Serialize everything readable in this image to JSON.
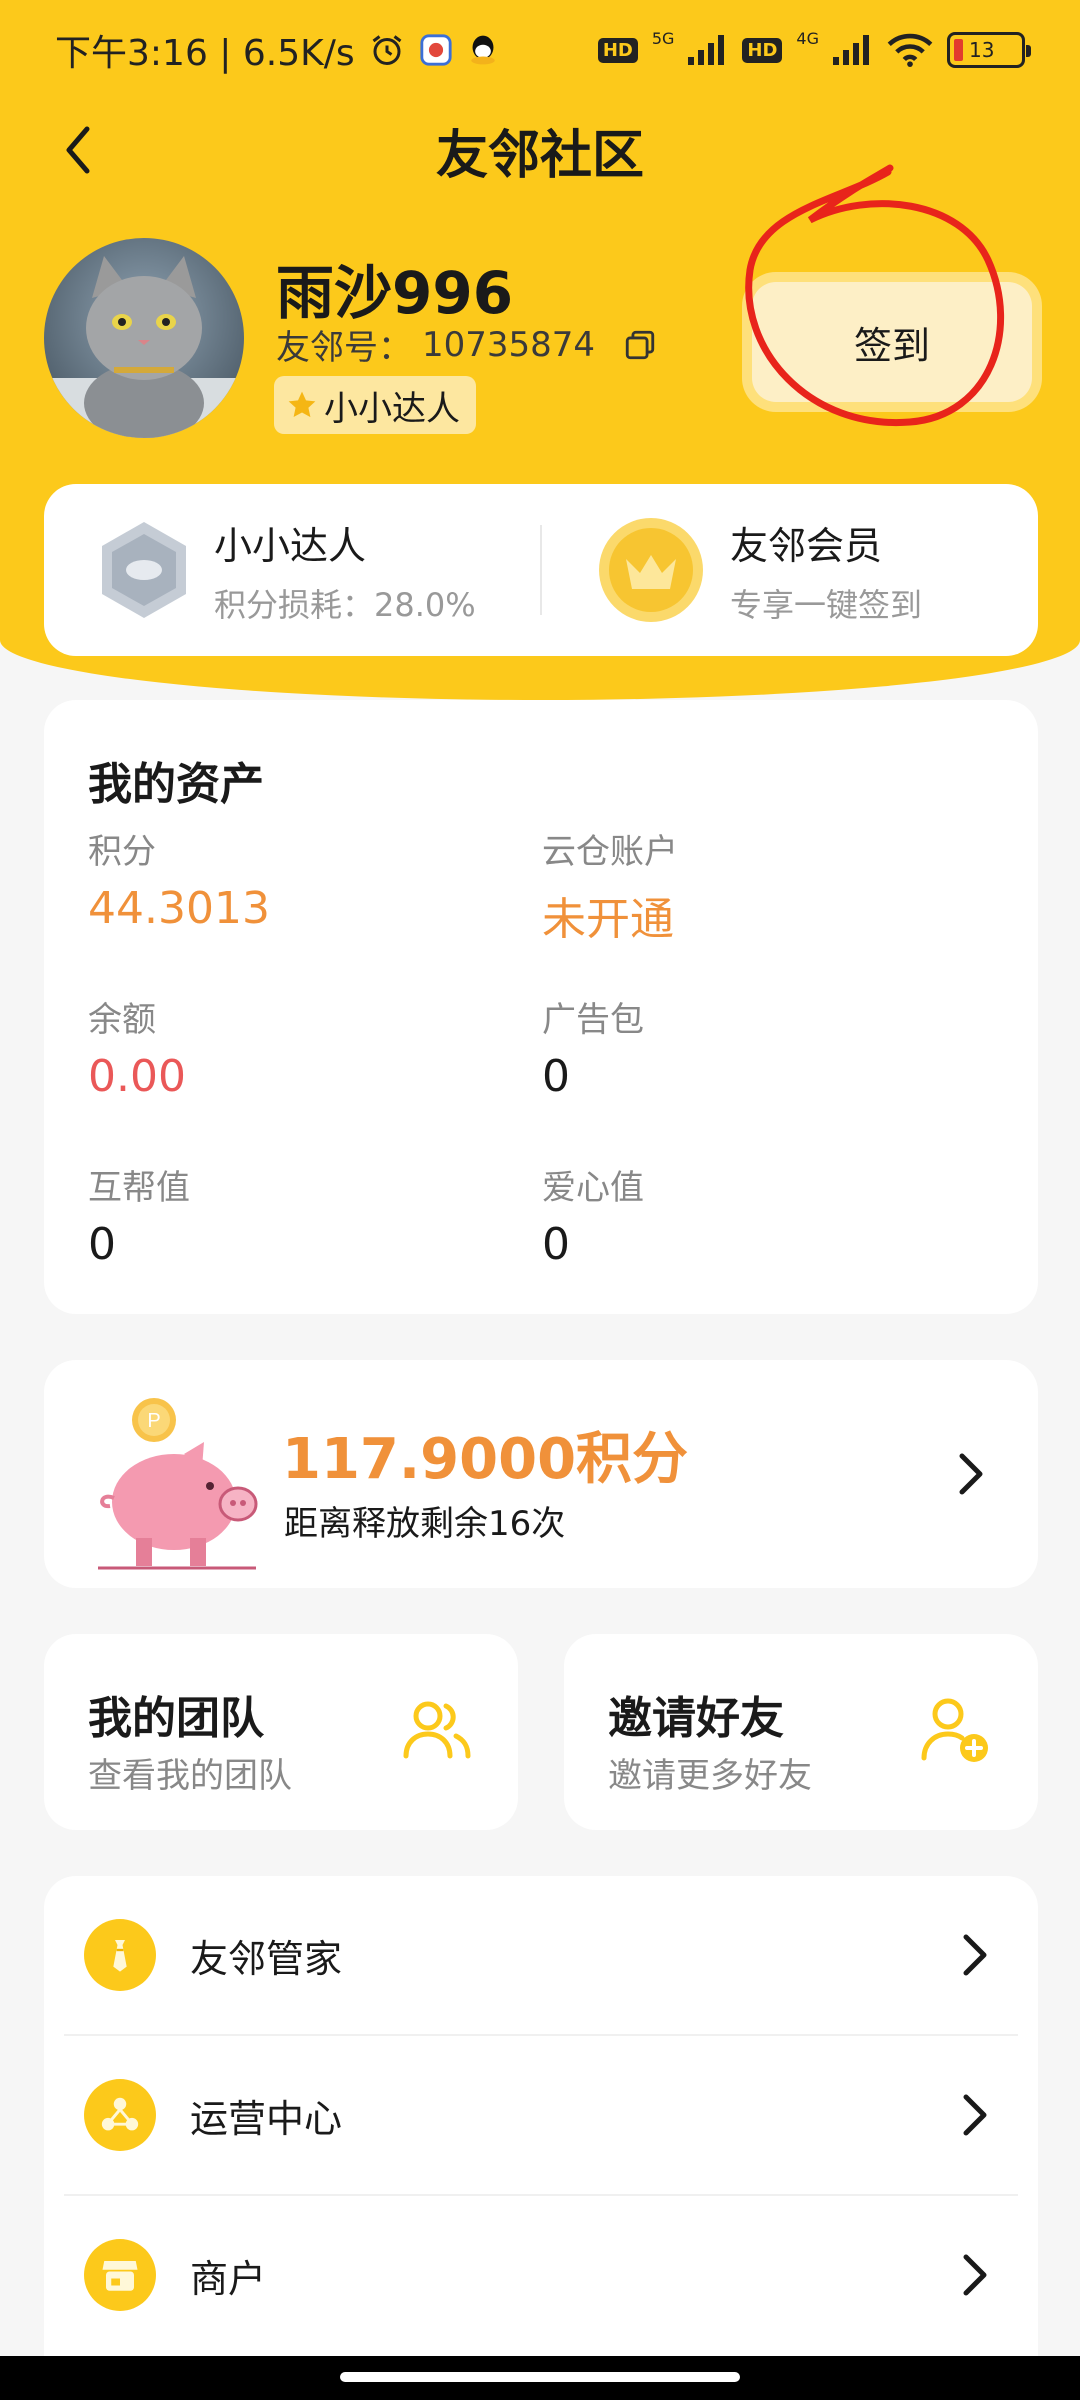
{
  "status_bar": {
    "time_speed": "下午3:16 | 6.5K/s",
    "hd_label": "HD",
    "net1": "5G",
    "net2": "4G",
    "battery": "13"
  },
  "header": {
    "title": "友邻社区"
  },
  "profile": {
    "name": "雨沙996",
    "id_label": "友邻号：",
    "id_value": "10735874",
    "level": "小小达人",
    "signin_label": "签到"
  },
  "stats": {
    "left_title": "小小达人",
    "left_sub": "积分损耗：28.0%",
    "right_title": "友邻会员",
    "right_sub": "专享一键签到"
  },
  "assets": {
    "title": "我的资产",
    "items": [
      {
        "label": "积分",
        "value": "44.3013"
      },
      {
        "label": "云仓账户",
        "value": "未开通"
      },
      {
        "label": "余额",
        "value": "0.00"
      },
      {
        "label": "广告包",
        "value": "0"
      },
      {
        "label": "互帮值",
        "value": "0"
      },
      {
        "label": "爱心值",
        "value": "0"
      }
    ]
  },
  "piggy": {
    "coin_letter": "P",
    "amount": "117.9000积分",
    "sub": "距离释放剩余16次"
  },
  "team": {
    "title": "我的团队",
    "sub": "查看我的团队"
  },
  "invite": {
    "title": "邀请好友",
    "sub": "邀请更多好友"
  },
  "menu": [
    {
      "label": "友邻管家",
      "icon": "tie-icon"
    },
    {
      "label": "运营中心",
      "icon": "network-icon"
    },
    {
      "label": "商户",
      "icon": "shop-icon"
    }
  ],
  "colors": {
    "brand_yellow": "#fcc91b",
    "accent_orange": "#f0913a",
    "accent_red": "#ea5858",
    "annotation_red": "#e8241b"
  }
}
